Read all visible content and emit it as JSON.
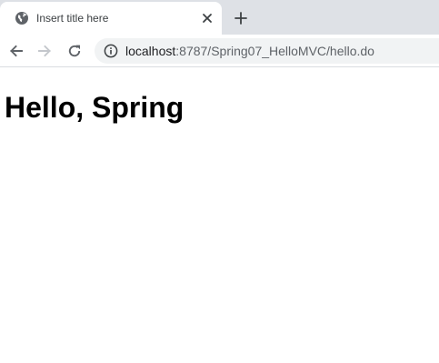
{
  "browser": {
    "tab": {
      "title": "Insert title here",
      "favicon": "globe-icon",
      "close_icon": "close-icon"
    },
    "new_tab_icon": "plus-icon",
    "toolbar": {
      "back_icon": "arrow-left-icon",
      "forward_icon": "arrow-right-icon",
      "forward_enabled": false,
      "reload_icon": "reload-icon",
      "site_info_icon": "info-icon"
    },
    "address": {
      "host": "localhost",
      "rest": ":8787/Spring07_HelloMVC/hello.do"
    }
  },
  "page": {
    "heading": "Hello, Spring"
  },
  "colors": {
    "tabstrip_bg": "#dee1e6",
    "omnibox_bg": "#f1f3f4",
    "icon": "#5f6368",
    "icon_disabled": "#c4c7cc",
    "heading": "#000000"
  }
}
